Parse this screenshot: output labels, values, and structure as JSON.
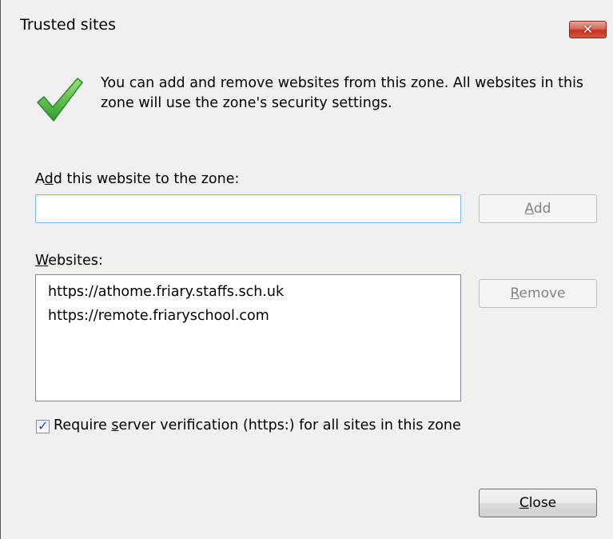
{
  "window": {
    "title": "Trusted sites",
    "close_glyph": "✕"
  },
  "info": {
    "icon": "checkmark-icon",
    "text": "You can add and remove websites from this zone. All websites in this zone will use the zone's security settings."
  },
  "add_section": {
    "label_pre": "A",
    "label_accel": "d",
    "label_post": "d this website to the zone:",
    "input_value": "",
    "add_button_accel": "A",
    "add_button_rest": "dd",
    "add_button_disabled": true
  },
  "websites_section": {
    "label_accel": "W",
    "label_rest": "ebsites:",
    "items": [
      "https://athome.friary.staffs.sch.uk",
      "https://remote.friaryschool.com"
    ],
    "remove_button_accel": "R",
    "remove_button_rest": "emove",
    "remove_button_disabled": true
  },
  "verification": {
    "checked": true,
    "label_pre": "Require ",
    "label_accel": "s",
    "label_post": "erver verification (https:) for all sites in this zone"
  },
  "footer": {
    "close_button_accel": "C",
    "close_button_rest": "lose"
  },
  "colors": {
    "dialog_bg": "#f0f0f0",
    "close_x_red": "#c3331f",
    "check_green": "#3cb043",
    "input_focus_border": "#7eb4ea"
  }
}
